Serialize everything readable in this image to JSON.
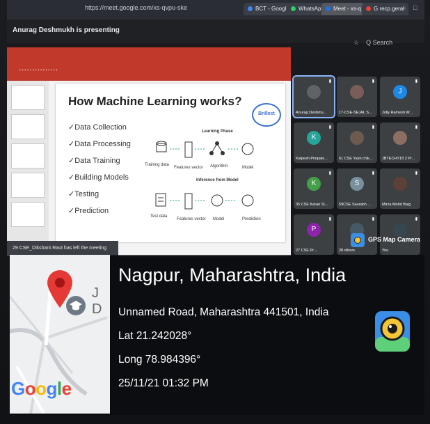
{
  "browser": {
    "url": "https://meet.google.com/xs-qvpu-ske",
    "tabs": [
      {
        "label": "BCT - Googl",
        "color": "#4285f4"
      },
      {
        "label": "WhatsApp",
        "color": "#25d366"
      },
      {
        "label": "Meet - xs-q",
        "color": "#1a73e8"
      },
      {
        "label": "G recp.geral",
        "color": "#ea4335"
      }
    ],
    "search_label": "Q Search"
  },
  "meet": {
    "presenting_text": "Anurag Deshmukh is presenting",
    "left_message": "29 CSE_Dikshant Raut has left the meeting"
  },
  "slide": {
    "title": "How Machine Learning works?",
    "bullets": [
      "✓Data Collection",
      "✓Data Processing",
      "✓Data Training",
      "✓Building Models",
      "✓Testing",
      "✓Prediction"
    ],
    "learning_phase": "Learning Phase",
    "inference_phase": "Inference from Model",
    "training_labels": [
      "Training data",
      "Features vector",
      "Algorithm",
      "Model"
    ],
    "inference_labels": [
      "Test data",
      "Features vector",
      "Model",
      "Prediction"
    ],
    "logo_text": "Brillect"
  },
  "participants": [
    {
      "name": "Anurag Deshmu...",
      "initial": "",
      "color": "#5f6368",
      "active": true
    },
    {
      "name": "17-CSE-SEJAL S...",
      "initial": "",
      "color": "#7a5c58",
      "active": false
    },
    {
      "name": "Jolly Ramesh W...",
      "initial": "J",
      "color": "#1e88e5",
      "active": false
    },
    {
      "name": "Kalpesh Pimpale...",
      "initial": "K",
      "color": "#26a69a",
      "active": false
    },
    {
      "name": "61 CSE Yash chik...",
      "initial": "",
      "color": "#6d5b4f",
      "active": false
    },
    {
      "name": "JBTECHY18 2 Pr...",
      "initial": "",
      "color": "#8d6e63",
      "active": false
    },
    {
      "name": "35 CSE Karan Si...",
      "initial": "K",
      "color": "#43a047",
      "active": false
    },
    {
      "name": "59CSE Saurabh ...",
      "initial": "S",
      "color": "#78909c",
      "active": false
    },
    {
      "name": "Mirza Mohd Baig",
      "initial": "",
      "color": "#5d4037",
      "active": false
    },
    {
      "name": "27 CSE Pr...",
      "initial": "P",
      "color": "#8e24aa",
      "active": false
    },
    {
      "name": "28 others",
      "initial": "",
      "color": "#455a64",
      "active": false
    },
    {
      "name": "You",
      "initial": "",
      "color": "#37474f",
      "active": false
    }
  ],
  "gps": {
    "app_label": "GPS Map Camera",
    "city": "Nagpur, Maharashtra, India",
    "address": "Unnamed Road, Maharashtra 441501, India",
    "lat": "Lat 21.242028°",
    "long": "Long 78.984396°",
    "datetime": "25/11/21 01:32 PM",
    "map_label": "J D",
    "google_brand": "Google",
    "pin_color": "#e53935"
  }
}
